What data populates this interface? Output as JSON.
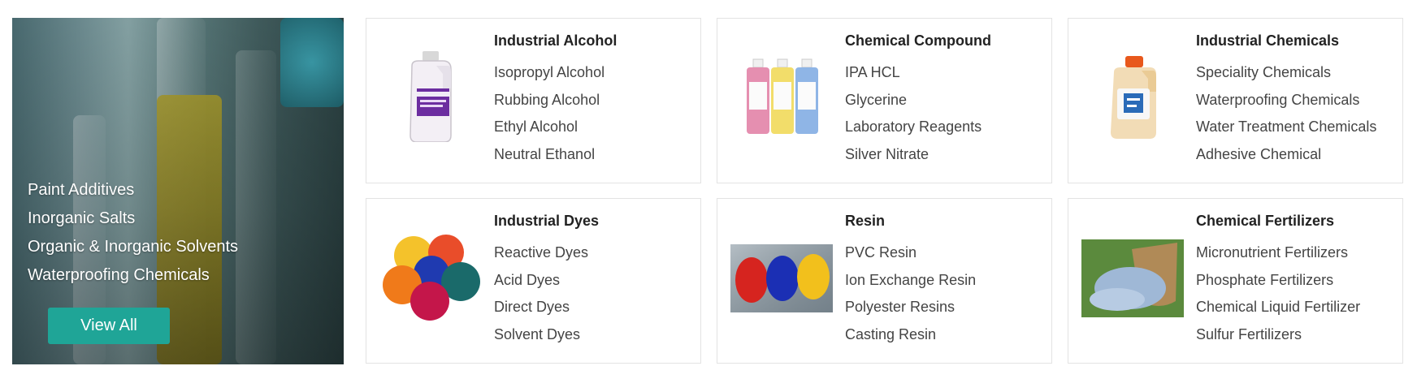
{
  "hero": {
    "links": [
      "Paint Additives",
      "Inorganic Salts",
      "Organic & Inorganic Solvents",
      "Waterproofing Chemicals"
    ],
    "button_label": "View All",
    "button_color": "#1fa597"
  },
  "cards": [
    {
      "title": "Industrial Alcohol",
      "icon": "alcohol-jug-icon",
      "items": [
        "Isopropyl Alcohol",
        "Rubbing Alcohol",
        "Ethyl Alcohol",
        "Neutral Ethanol"
      ]
    },
    {
      "title": "Chemical Compound",
      "icon": "ph-buffer-bottles-icon",
      "items": [
        "IPA HCL",
        "Glycerine",
        "Laboratory Reagents",
        "Silver Nitrate"
      ]
    },
    {
      "title": "Industrial Chemicals",
      "icon": "chemical-jug-icon",
      "items": [
        "Speciality Chemicals",
        "Waterproofing Chemicals",
        "Water Treatment Chemicals",
        "Adhesive Chemical"
      ]
    },
    {
      "title": "Industrial Dyes",
      "icon": "dye-powder-icon",
      "items": [
        "Reactive Dyes",
        "Acid Dyes",
        "Direct Dyes",
        "Solvent Dyes"
      ]
    },
    {
      "title": "Resin",
      "icon": "resin-granules-icon",
      "items": [
        "PVC Resin",
        "Ion Exchange Resin",
        "Polyester Resins",
        "Casting Resin"
      ]
    },
    {
      "title": "Chemical Fertilizers",
      "icon": "fertilizer-sack-icon",
      "items": [
        "Micronutrient Fertilizers",
        "Phosphate Fertilizers",
        "Chemical Liquid Fertilizer",
        "Sulfur Fertilizers"
      ]
    }
  ]
}
